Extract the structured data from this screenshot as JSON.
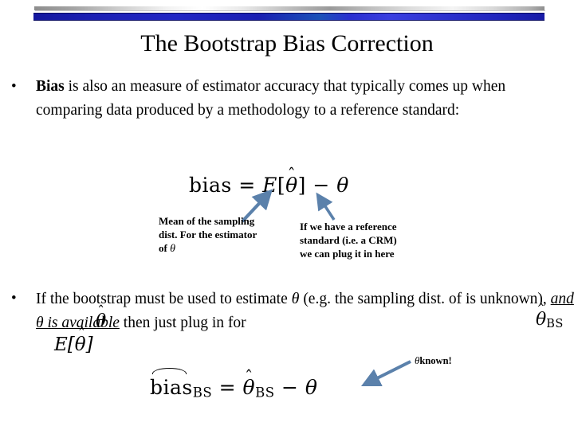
{
  "slide": {
    "title": "The Bootstrap Bias Correction",
    "background_color": "#ffffff",
    "text_color": "#000000"
  },
  "header": {
    "silver_bar_color": "#bdbdbd",
    "blue_bar_color": "#1c20b4"
  },
  "bullets": [
    {
      "marker": "•",
      "lead_bold": "Bias",
      "text": " is also an measure of estimator accuracy that typically comes up when comparing data produced by a methodology to a reference standard:"
    },
    {
      "marker": "•",
      "part_1": "If the bootstrap must be used to estimate ",
      "theta_1": "θ",
      "part_2": " (e.g. the sampling dist. of ",
      "part_3": "   is unknown), ",
      "emph_and": "and",
      "emph_theta_avail": "θ is available",
      "part_4": " then just plug in          for",
      "part_5": ""
    }
  ],
  "equations": {
    "main": {
      "lhs": "bias",
      "eq": "=",
      "expectation": "E",
      "bracket_open": "[",
      "theta_hat": "θ",
      "hat": "ˆ",
      "bracket_close": "]",
      "minus": "−",
      "theta": "θ",
      "plain": "bias = E[θ̂] − θ"
    },
    "bootstrap": {
      "lhs": "bias",
      "lhs_sub": "BS",
      "eq": "=",
      "theta_hat": "θ",
      "rhs_sub": "BS",
      "minus": "−",
      "theta": "θ",
      "plain": "biaŝ_BS = θ̂_BS − θ"
    },
    "expectation_inline": {
      "expectation": "E",
      "bracket_open": "[",
      "theta_hat": "θ",
      "bracket_close": "]",
      "plain": "E[θ̂]"
    },
    "theta_hat_overlap": "θ",
    "theta_hat_bs_overlap": "θ",
    "theta_hat_bs_sub": "BS",
    "theta_bottom_right": "θ"
  },
  "callouts": [
    {
      "id": "left",
      "line_1": "Mean of the sampling",
      "line_2": "dist. For the estimator",
      "line_3_prefix": "of ",
      "line_3_theta": "θ"
    },
    {
      "id": "right",
      "line_1": "If we have a reference",
      "line_2": "standard (i.e. a CRM)",
      "line_3": "we can plug it in here"
    },
    {
      "id": "known",
      "theta": "θ",
      "text": "known!"
    }
  ],
  "arrows": {
    "color": "#5b81ab",
    "items": [
      {
        "name": "arrow-to-expectation",
        "direction": "up-right"
      },
      {
        "name": "arrow-to-theta",
        "direction": "up-left"
      },
      {
        "name": "arrow-to-theta-known",
        "direction": "down-left"
      }
    ]
  }
}
